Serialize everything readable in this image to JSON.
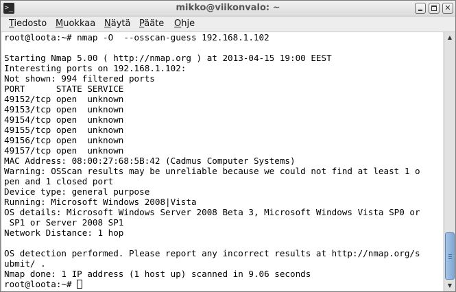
{
  "window": {
    "title": "mikko@viikonvalo: ~",
    "icon": "terminal-icon"
  },
  "menubar": {
    "items": [
      {
        "mnemonic": "T",
        "rest": "iedosto"
      },
      {
        "mnemonic": "M",
        "rest": "uokkaa"
      },
      {
        "mnemonic": "N",
        "rest": "äytä"
      },
      {
        "mnemonic": "P",
        "rest": "ääte"
      },
      {
        "mnemonic": "O",
        "rest": "hje"
      }
    ]
  },
  "terminal": {
    "lines": [
      "root@loota:~# nmap -O  --osscan-guess 192.168.1.102",
      "",
      "Starting Nmap 5.00 ( http://nmap.org ) at 2013-04-15 19:00 EEST",
      "Interesting ports on 192.168.1.102:",
      "Not shown: 994 filtered ports",
      "PORT      STATE SERVICE",
      "49152/tcp open  unknown",
      "49153/tcp open  unknown",
      "49154/tcp open  unknown",
      "49155/tcp open  unknown",
      "49156/tcp open  unknown",
      "49157/tcp open  unknown",
      "MAC Address: 08:00:27:68:5B:42 (Cadmus Computer Systems)",
      "Warning: OSScan results may be unreliable because we could not find at least 1 o",
      "pen and 1 closed port",
      "Device type: general purpose",
      "Running: Microsoft Windows 2008|Vista",
      "OS details: Microsoft Windows Server 2008 Beta 3, Microsoft Windows Vista SP0 or",
      " SP1 or Server 2008 SP1",
      "Network Distance: 1 hop",
      "",
      "OS detection performed. Please report any incorrect results at http://nmap.org/s",
      "ubmit/ .",
      "Nmap done: 1 IP address (1 host up) scanned in 9.06 seconds"
    ],
    "prompt": "root@loota:~# "
  },
  "scrollbar": {
    "position": 1.0,
    "visible_fraction": 0.2
  },
  "colors": {
    "terminal_bg": "#ffffff",
    "terminal_fg": "#000000",
    "scroll_thumb": "#7ea6d4"
  }
}
